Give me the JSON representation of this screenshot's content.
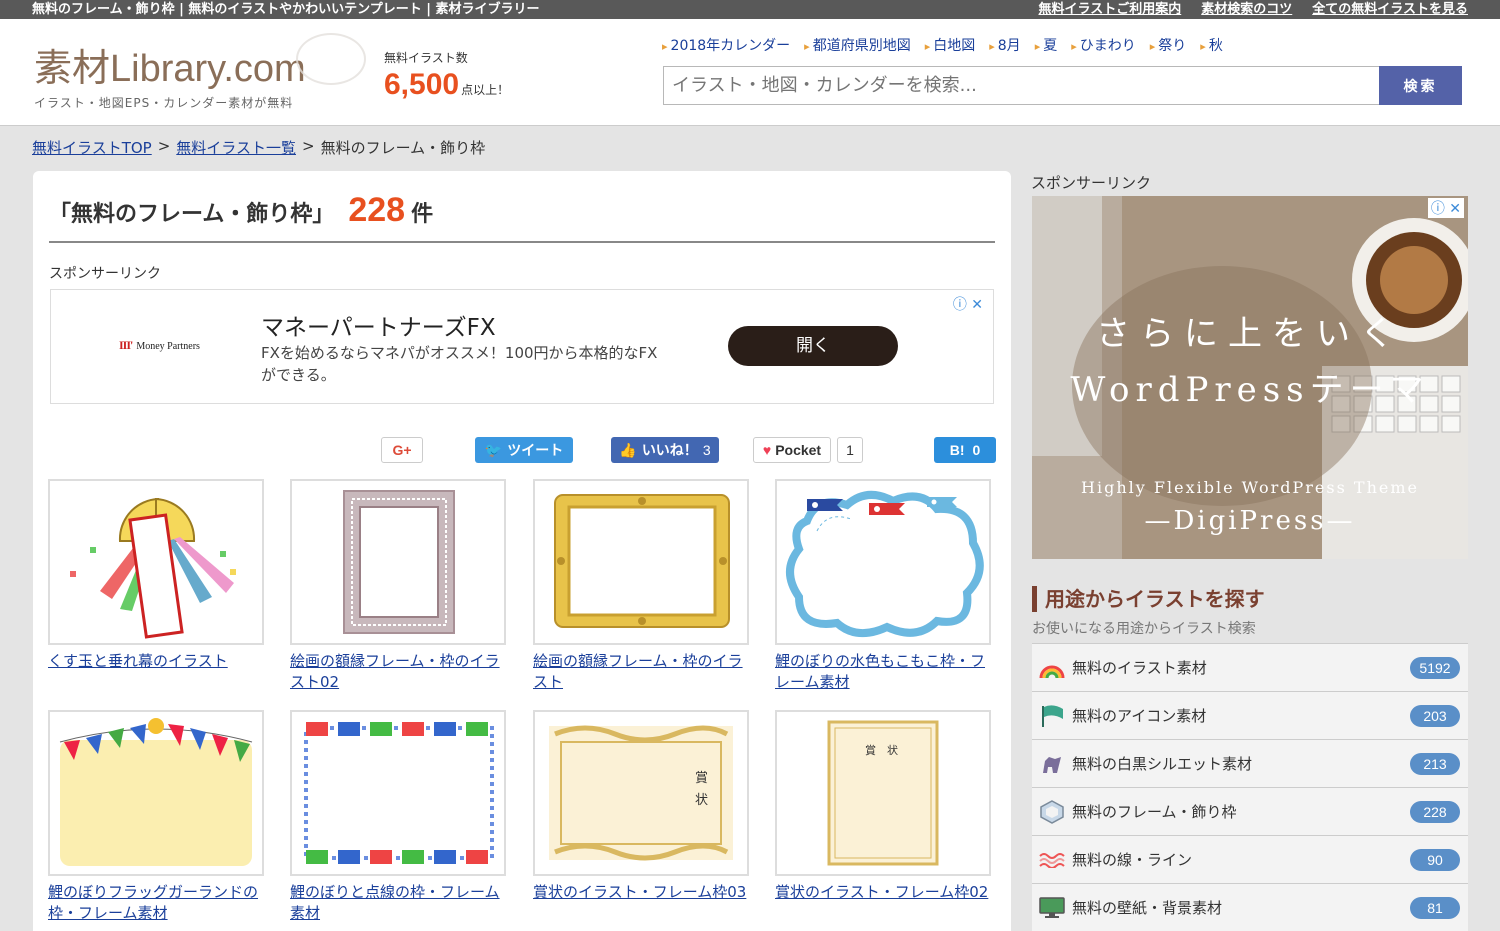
{
  "topbar": {
    "tagline": "無料のフレーム・飾り枠 | 無料のイラストやかわいいテンプレート | 素材ライブラリー",
    "links": [
      "無料イラストご利用案内",
      "素材検索のコツ",
      "全ての無料イラストを見る"
    ]
  },
  "header": {
    "logo_text": "素材Library.com",
    "logo_sub": "イラスト・地図EPS・カレンダー素材が無料",
    "count_label": "無料イラスト数",
    "count_value": "6,500",
    "count_suffix": "点以上！",
    "quick_links": [
      "2018年カレンダー",
      "都道府県別地図",
      "白地図",
      "8月",
      "夏",
      "ひまわり",
      "祭り",
      "秋"
    ],
    "search_placeholder": "イラスト・地図・カレンダーを検索...",
    "search_button": "検索"
  },
  "breadcrumb": {
    "items": [
      "無料イラストTOP",
      "無料イラスト一覧"
    ],
    "separator": ">",
    "current": "無料のフレーム・飾り枠"
  },
  "main": {
    "title": "「無料のフレーム・飾り枠」",
    "count": "228",
    "count_unit": "件",
    "sponsor_label": "スポンサーリンク",
    "ad": {
      "brand": "Money Partners",
      "headline": "マネーパートナーズFX",
      "body": "FXを始めるならマネパがオススメ！100円から本格的なFXができる。",
      "button": "開く"
    },
    "social": {
      "gplus": "G+",
      "tweet": "ツイート",
      "like": "いいね！",
      "like_count": "3",
      "pocket": "Pocket",
      "pocket_count": "1",
      "hatena": "B!",
      "hatena_count": "0"
    },
    "items": [
      {
        "caption": "くす玉と垂れ幕のイラスト"
      },
      {
        "caption": "絵画の額縁フレーム・枠のイラスト02"
      },
      {
        "caption": "絵画の額縁フレーム・枠のイラスト"
      },
      {
        "caption": "鯉のぼりの水色もこもこ枠・フレーム素材"
      },
      {
        "caption": "鯉のぼりフラッグガーランドの枠・フレーム素材"
      },
      {
        "caption": "鯉のぼりと点線の枠・フレーム素材"
      },
      {
        "caption": "賞状のイラスト・フレーム枠03"
      },
      {
        "caption": "賞状のイラスト・フレーム枠02"
      }
    ],
    "award_text": "賞状"
  },
  "sidebar": {
    "sponsor_label": "スポンサーリンク",
    "ad": {
      "line1": "さらに上をいく",
      "line2": "WordPressテーマ",
      "line3": "Highly Flexible WordPress Theme",
      "line4": "—DigiPress—"
    },
    "categories_title": "用途からイラストを探す",
    "categories_sub": "お使いになる用途からイラスト検索",
    "categories": [
      {
        "label": "無料のイラスト素材",
        "count": "5192",
        "icon": "rainbow-icon"
      },
      {
        "label": "無料のアイコン素材",
        "count": "203",
        "icon": "flag-icon"
      },
      {
        "label": "無料の白黒シルエット素材",
        "count": "213",
        "icon": "silhouette-icon"
      },
      {
        "label": "無料のフレーム・飾り枠",
        "count": "228",
        "icon": "frame-icon"
      },
      {
        "label": "無料の線・ライン",
        "count": "90",
        "icon": "wave-line-icon"
      },
      {
        "label": "無料の壁紙・背景素材",
        "count": "81",
        "icon": "monitor-icon"
      }
    ]
  },
  "colors": {
    "accent_orange": "#e8501f",
    "link_blue": "#1a3f9a",
    "search_button": "#5462a8",
    "badge_blue": "#5a8fc8",
    "category_heading": "#7a4030"
  }
}
